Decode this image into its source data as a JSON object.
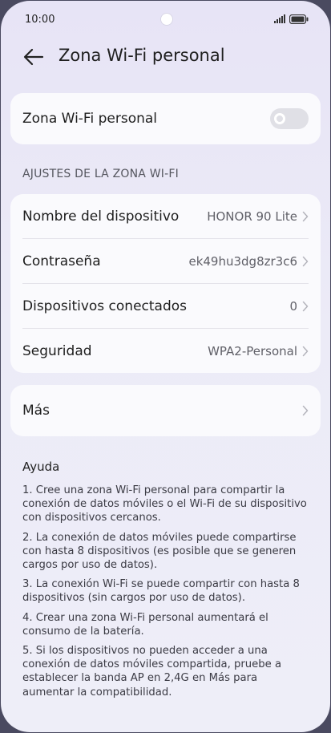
{
  "status_bar": {
    "time": "10:00"
  },
  "header": {
    "title": "Zona Wi-Fi personal"
  },
  "hotspot": {
    "label": "Zona Wi-Fi personal",
    "enabled": false
  },
  "settings_section": {
    "title": "AJUSTES DE LA ZONA WI-FI",
    "items": [
      {
        "label": "Nombre del dispositivo",
        "value": "HONOR 90 Lite"
      },
      {
        "label": "Contraseña",
        "value": "ek49hu3dg8zr3c6"
      },
      {
        "label": "Dispositivos conectados",
        "value": "0"
      },
      {
        "label": "Seguridad",
        "value": "WPA2-Personal"
      }
    ]
  },
  "more": {
    "label": "Más"
  },
  "help": {
    "title": "Ayuda",
    "paragraphs": [
      "1. Cree una zona Wi-Fi personal para compartir la conexión de datos móviles o el Wi-Fi de su dispositivo con dispositivos cercanos.",
      "2. La conexión de datos móviles puede compartirse con hasta 8 dispositivos (es posible que se generen cargos por uso de datos).",
      "3. La conexión Wi-Fi se puede compartir con hasta 8 dispositivos (sin cargos por uso de datos).",
      "4. Crear una zona Wi-Fi personal aumentará el consumo de la batería.",
      "5. Si los dispositivos no pueden acceder a una conexión de datos móviles compartida, pruebe a establecer la banda AP en 2,4G en Más para aumentar la compatibilidad."
    ]
  },
  "icons": {
    "back": "arrow-left-icon",
    "chevron": "chevron-right-icon",
    "signal": "signal-icon",
    "battery": "battery-icon"
  }
}
